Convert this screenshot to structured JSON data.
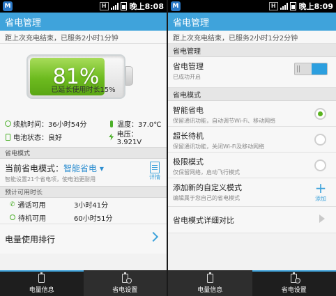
{
  "left": {
    "status": {
      "time": "晚上8:08",
      "h": "H"
    },
    "title": "省电管理",
    "since_charge": "距上次充电结束，已服务2小时1分钟",
    "battery_percent": "81%",
    "battery_level": 0.81,
    "extended": "已延长使用时长15%",
    "stats": {
      "runtime": "续航时间：36小时54分",
      "temperature": "温度：37.0℃",
      "battery_status": "电池状态：良好",
      "voltage": "电压：3.921V"
    },
    "mode_section": "省电模式",
    "current_mode_prefix": "当前省电模式：",
    "current_mode": "智能省电",
    "current_mode_desc": "智能设置21个省电项，使电池更耐用",
    "detail_label": "详情",
    "estimate_section": "预计可用时长",
    "call_label": "通话可用",
    "call_value": "3小时41分",
    "standby_label": "待机可用",
    "standby_value": "60小时51分",
    "usage_rank": "电量使用排行",
    "tabs": [
      "电量信息",
      "省电设置"
    ]
  },
  "right": {
    "status": {
      "time": "晚上8:09",
      "h": "H"
    },
    "title": "省电管理",
    "since_charge": "距上次充电结束，已服务2小时1分2分钟",
    "section1": "省电管理",
    "power_mgmt_title": "省电管理",
    "power_mgmt_desc": "已成功开启",
    "section2": "省电模式",
    "modes": [
      {
        "title": "智能省电",
        "desc": "保留通讯功能，自动调节Wi-Fi、移动网络",
        "selected": true
      },
      {
        "title": "超长待机",
        "desc": "保留通讯功能，关闭Wi-Fi及移动网络",
        "selected": false
      },
      {
        "title": "极限模式",
        "desc": "仅保留网络，启动飞行模式",
        "selected": false
      }
    ],
    "add_title": "添加新的自定义模式",
    "add_desc": "编辑属于您自己的省电模式",
    "add_label": "添加",
    "compare": "省电模式详细对比",
    "tabs": [
      "电量信息",
      "省电设置"
    ]
  },
  "colors": {
    "accent": "#3fa3db",
    "battery_green": "#6dbb1f",
    "radio_green": "#59b31f"
  }
}
